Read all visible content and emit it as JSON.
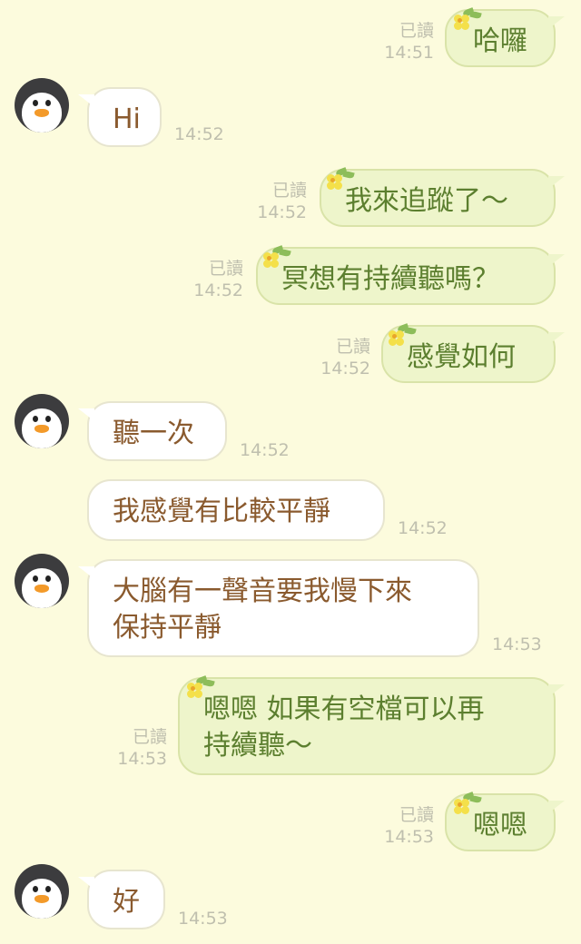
{
  "colors": {
    "background": "#fcfbdd",
    "incoming_bubble": "#ffffff",
    "incoming_text": "#8a5a2e",
    "outgoing_bubble": "#eef5cb",
    "outgoing_text": "#5c7f2f",
    "meta_text": "#bfbfae"
  },
  "messages": [
    {
      "dir": "out",
      "text": "哈囉",
      "read": "已讀",
      "time": "14:51"
    },
    {
      "dir": "in",
      "text": "Hi",
      "time": "14:52"
    },
    {
      "dir": "out",
      "text": "我來追蹤了～",
      "read": "已讀",
      "time": "14:52"
    },
    {
      "dir": "out",
      "text": "冥想有持續聽嗎？",
      "read": "已讀",
      "time": "14:52"
    },
    {
      "dir": "out",
      "text": "感覺如何",
      "read": "已讀",
      "time": "14:52"
    },
    {
      "dir": "in",
      "text": "聽一次",
      "time": "14:52"
    },
    {
      "dir": "in",
      "text": "我感覺有比較平靜",
      "time": "14:52"
    },
    {
      "dir": "in",
      "text_lines": [
        "大腦有一聲音要我慢下來",
        "保持平靜"
      ],
      "time": "14:53"
    },
    {
      "dir": "out",
      "text_lines": [
        "嗯嗯  如果有空檔可以再",
        "持續聽～"
      ],
      "read": "已讀",
      "time": "14:53"
    },
    {
      "dir": "out",
      "text": "嗯嗯",
      "read": "已讀",
      "time": "14:53"
    },
    {
      "dir": "in",
      "text": "好",
      "time": "14:53"
    }
  ],
  "icons": {
    "avatar": "penguin-avatar-icon",
    "decoration": "flower-icon"
  }
}
